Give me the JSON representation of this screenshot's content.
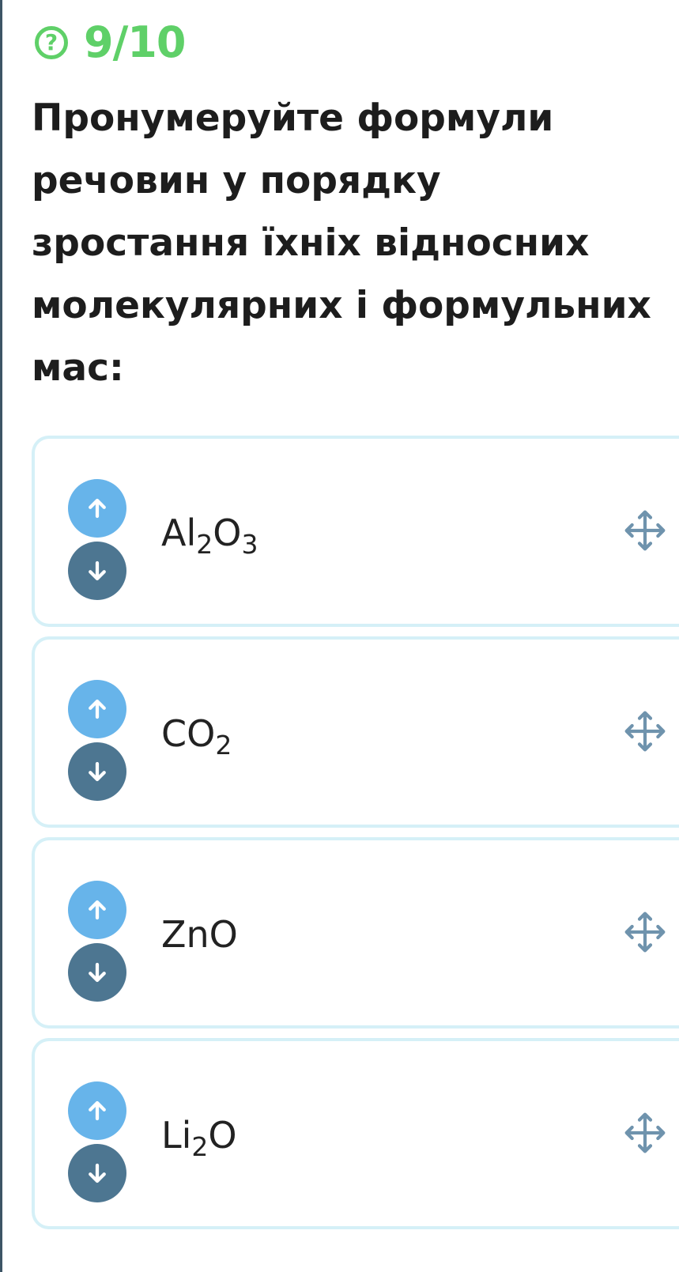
{
  "header": {
    "help_icon": "question-circle-icon",
    "help_glyph": "?",
    "counter": "9/10",
    "accent_color": "#5fd068"
  },
  "question": {
    "lines": [
      "Пронумеруйте формули",
      "речовин у порядку",
      "зростання їхніх відносних",
      "молекулярних і формульних",
      "мас:"
    ]
  },
  "colors": {
    "up_button": "#67b4ea",
    "down_button": "#4d7691",
    "card_border": "#d5f0f7",
    "move_icon": "#6f93ad"
  },
  "items": [
    {
      "parts": [
        {
          "t": "Al"
        },
        {
          "s": "2"
        },
        {
          "t": "O"
        },
        {
          "s": "3"
        }
      ],
      "up_icon": "arrow-up-icon",
      "down_icon": "arrow-down-icon",
      "drag_icon": "move-icon"
    },
    {
      "parts": [
        {
          "t": "CO"
        },
        {
          "s": "2"
        }
      ],
      "up_icon": "arrow-up-icon",
      "down_icon": "arrow-down-icon",
      "drag_icon": "move-icon"
    },
    {
      "parts": [
        {
          "t": "ZnO"
        }
      ],
      "up_icon": "arrow-up-icon",
      "down_icon": "arrow-down-icon",
      "drag_icon": "move-icon"
    },
    {
      "parts": [
        {
          "t": "Li"
        },
        {
          "s": "2"
        },
        {
          "t": "O"
        }
      ],
      "up_icon": "arrow-up-icon",
      "down_icon": "arrow-down-icon",
      "drag_icon": "move-icon"
    }
  ]
}
